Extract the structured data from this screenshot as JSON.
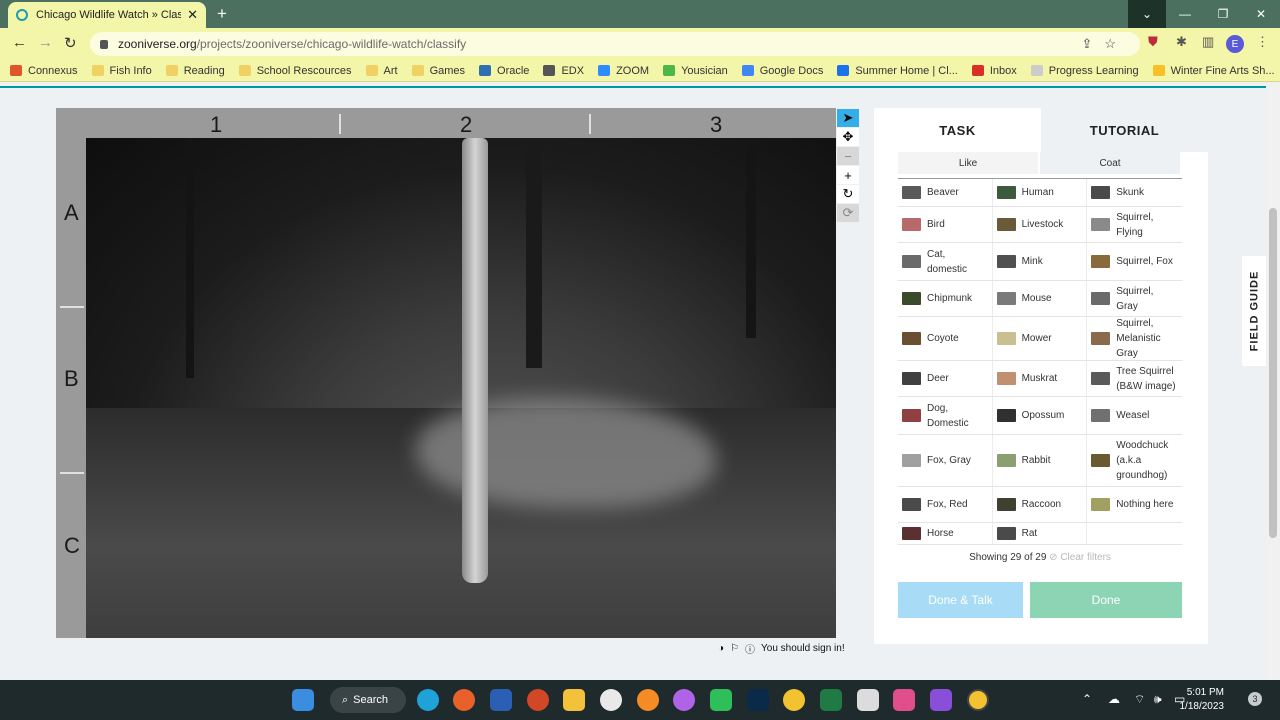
{
  "browser": {
    "tab_title": "Chicago Wildlife Watch » Classify",
    "url_host": "zooniverse.org",
    "url_path": "/projects/zooniverse/chicago-wildlife-watch/classify",
    "avatar_letter": "E",
    "bookmarks": [
      {
        "label": "Connexus",
        "color": "#e0562c"
      },
      {
        "label": "Fish Info",
        "color": "#f0d264"
      },
      {
        "label": "Reading",
        "color": "#f0d264"
      },
      {
        "label": "School Rescources",
        "color": "#f0d264"
      },
      {
        "label": "Art",
        "color": "#f0d264"
      },
      {
        "label": "Games",
        "color": "#f0d264"
      },
      {
        "label": "Oracle",
        "color": "#2f6fb0"
      },
      {
        "label": "EDX",
        "color": "#555555"
      },
      {
        "label": "ZOOM",
        "color": "#2d8cff"
      },
      {
        "label": "Yousician",
        "color": "#4cb648"
      },
      {
        "label": "Google Docs",
        "color": "#4285f4"
      },
      {
        "label": "Summer Home | Cl...",
        "color": "#1a73e8"
      },
      {
        "label": "Inbox",
        "color": "#d93025"
      },
      {
        "label": "Progress Learning",
        "color": "#cccccc"
      },
      {
        "label": "Winter Fine Arts Sh...",
        "color": "#f6c026"
      }
    ]
  },
  "viewer": {
    "columns": [
      "1",
      "2",
      "3"
    ],
    "rows": [
      "A",
      "B",
      "C"
    ],
    "footer_text": "You should sign in!"
  },
  "panel": {
    "tab_task": "TASK",
    "tab_tutorial": "TUTORIAL",
    "filters": [
      "Like",
      "Coat"
    ],
    "species": [
      [
        "Beaver",
        "Human",
        "Skunk"
      ],
      [
        "Bird",
        "Livestock",
        "Squirrel, Flying"
      ],
      [
        "Cat, domestic",
        "Mink",
        "Squirrel, Fox"
      ],
      [
        "Chipmunk",
        "Mouse",
        "Squirrel, Gray"
      ],
      [
        "Coyote",
        "Mower",
        "Squirrel, Melanistic Gray"
      ],
      [
        "Deer",
        "Muskrat",
        "Tree Squirrel (B&W image)"
      ],
      [
        "Dog, Domestic",
        "Opossum",
        "Weasel"
      ],
      [
        "Fox, Gray",
        "Rabbit",
        "Woodchuck (a.k.a groundhog)"
      ],
      [
        "Fox, Red",
        "Raccoon",
        "Nothing here"
      ],
      [
        "Horse",
        "Rat",
        ""
      ]
    ],
    "thumb_colors": [
      [
        "#5a5a5a",
        "#3d5a3d",
        "#4a4a4a"
      ],
      [
        "#b86a6a",
        "#6b5a3a",
        "#8a8a8a"
      ],
      [
        "#6a6a6a",
        "#505050",
        "#8a6a3a"
      ],
      [
        "#3a4a2a",
        "#7a7a7a",
        "#6a6a6a"
      ],
      [
        "#6a5030",
        "#c8c090",
        "#8a6a4a"
      ],
      [
        "#404040",
        "#c09070",
        "#5a5a5a"
      ],
      [
        "#904040",
        "#303030",
        "#707070"
      ],
      [
        "#a0a0a0",
        "#8aa070",
        "#6a5a30"
      ],
      [
        "#4a4a4a",
        "#404030",
        "#a0a060"
      ],
      [
        "#5a3030",
        "#4a4a4a",
        ""
      ]
    ],
    "showing_text": "Showing 29 of 29",
    "clear_filters": "Clear filters",
    "done_talk": "Done & Talk",
    "done": "Done",
    "field_guide": "FIELD GUIDE"
  },
  "taskbar": {
    "search_label": "Search",
    "time": "5:01 PM",
    "date": "1/18/2023",
    "notifications": "3",
    "chrome_badge": "E"
  }
}
